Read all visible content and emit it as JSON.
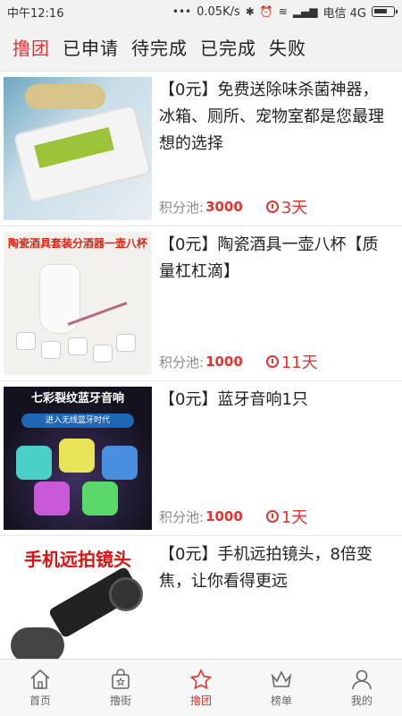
{
  "status_bar": {
    "left_text": "中午12:16",
    "dots": "•••",
    "speed": "0.05K/s",
    "icons": [
      "bluetooth-icon",
      "alarm-icon",
      "wifi-icon",
      "signal-icon"
    ],
    "carrier": "电信 4G",
    "battery_icon": "battery-icon"
  },
  "tabs": [
    {
      "label": "撸团",
      "active": true
    },
    {
      "label": "已申请",
      "active": false
    },
    {
      "label": "待完成",
      "active": false
    },
    {
      "label": "已完成",
      "active": false
    },
    {
      "label": "失败",
      "active": false
    }
  ],
  "items": [
    {
      "title": "【0元】免费送除味杀菌神器，冰箱、厕所、宠物室都是您最理想的选择",
      "pool_label": "积分池:",
      "pool_value": "3000",
      "days": "3天"
    },
    {
      "title": "【0元】陶瓷酒具一壶八杯【质量杠杠滴】",
      "pool_label": "积分池:",
      "pool_value": "1000",
      "days": "11天",
      "thumb_text": "陶瓷酒具套装分酒器一壶八杯"
    },
    {
      "title": "【0元】蓝牙音响1只",
      "pool_label": "积分池:",
      "pool_value": "1000",
      "days": "1天",
      "thumb_text": "七彩裂纹蓝牙音响",
      "thumb_sub": "进入无线蓝牙时代"
    },
    {
      "title": "【0元】手机远拍镜头，8倍变焦，让你看得更远",
      "thumb_text": "手机远拍镜头"
    }
  ],
  "bottom_nav": [
    {
      "label": "首页",
      "icon": "home-icon",
      "active": false
    },
    {
      "label": "撸街",
      "icon": "shopping-bag-icon",
      "active": false
    },
    {
      "label": "撸团",
      "icon": "star-icon",
      "active": true
    },
    {
      "label": "榜单",
      "icon": "crown-icon",
      "active": false
    },
    {
      "label": "我的",
      "icon": "user-icon",
      "active": false
    }
  ],
  "colors": {
    "accent": "#e8322e",
    "text": "#222222",
    "muted": "#888888"
  }
}
